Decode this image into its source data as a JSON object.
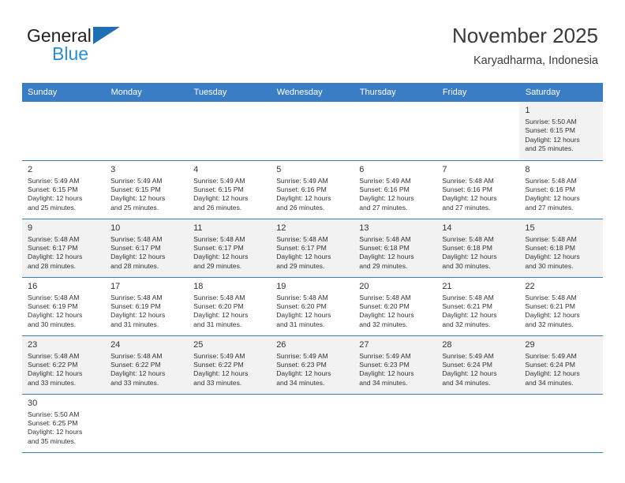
{
  "brand": {
    "line1": "General",
    "line2": "Blue",
    "triangle_color": "#1f6fb5",
    "blue_text_color": "#2a8fd8"
  },
  "header": {
    "title": "November 2025",
    "subtitle": "Karyadharma, Indonesia"
  },
  "theme": {
    "header_bg": "#3b7dc4",
    "header_text": "#ffffff",
    "row_shade": "#f2f2f2",
    "grid_line": "#3b7dc4"
  },
  "weekdays": [
    "Sunday",
    "Monday",
    "Tuesday",
    "Wednesday",
    "Thursday",
    "Friday",
    "Saturday"
  ],
  "weeks": [
    [
      {
        "empty": true
      },
      {
        "empty": true
      },
      {
        "empty": true
      },
      {
        "empty": true
      },
      {
        "empty": true
      },
      {
        "empty": true
      },
      {
        "day": "1",
        "sunrise": "Sunrise: 5:50 AM",
        "sunset": "Sunset: 6:15 PM",
        "daylight1": "Daylight: 12 hours",
        "daylight2": "and 25 minutes."
      }
    ],
    [
      {
        "day": "2",
        "sunrise": "Sunrise: 5:49 AM",
        "sunset": "Sunset: 6:15 PM",
        "daylight1": "Daylight: 12 hours",
        "daylight2": "and 25 minutes."
      },
      {
        "day": "3",
        "sunrise": "Sunrise: 5:49 AM",
        "sunset": "Sunset: 6:15 PM",
        "daylight1": "Daylight: 12 hours",
        "daylight2": "and 25 minutes."
      },
      {
        "day": "4",
        "sunrise": "Sunrise: 5:49 AM",
        "sunset": "Sunset: 6:15 PM",
        "daylight1": "Daylight: 12 hours",
        "daylight2": "and 26 minutes."
      },
      {
        "day": "5",
        "sunrise": "Sunrise: 5:49 AM",
        "sunset": "Sunset: 6:16 PM",
        "daylight1": "Daylight: 12 hours",
        "daylight2": "and 26 minutes."
      },
      {
        "day": "6",
        "sunrise": "Sunrise: 5:49 AM",
        "sunset": "Sunset: 6:16 PM",
        "daylight1": "Daylight: 12 hours",
        "daylight2": "and 27 minutes."
      },
      {
        "day": "7",
        "sunrise": "Sunrise: 5:48 AM",
        "sunset": "Sunset: 6:16 PM",
        "daylight1": "Daylight: 12 hours",
        "daylight2": "and 27 minutes."
      },
      {
        "day": "8",
        "sunrise": "Sunrise: 5:48 AM",
        "sunset": "Sunset: 6:16 PM",
        "daylight1": "Daylight: 12 hours",
        "daylight2": "and 27 minutes."
      }
    ],
    [
      {
        "day": "9",
        "sunrise": "Sunrise: 5:48 AM",
        "sunset": "Sunset: 6:17 PM",
        "daylight1": "Daylight: 12 hours",
        "daylight2": "and 28 minutes."
      },
      {
        "day": "10",
        "sunrise": "Sunrise: 5:48 AM",
        "sunset": "Sunset: 6:17 PM",
        "daylight1": "Daylight: 12 hours",
        "daylight2": "and 28 minutes."
      },
      {
        "day": "11",
        "sunrise": "Sunrise: 5:48 AM",
        "sunset": "Sunset: 6:17 PM",
        "daylight1": "Daylight: 12 hours",
        "daylight2": "and 29 minutes."
      },
      {
        "day": "12",
        "sunrise": "Sunrise: 5:48 AM",
        "sunset": "Sunset: 6:17 PM",
        "daylight1": "Daylight: 12 hours",
        "daylight2": "and 29 minutes."
      },
      {
        "day": "13",
        "sunrise": "Sunrise: 5:48 AM",
        "sunset": "Sunset: 6:18 PM",
        "daylight1": "Daylight: 12 hours",
        "daylight2": "and 29 minutes."
      },
      {
        "day": "14",
        "sunrise": "Sunrise: 5:48 AM",
        "sunset": "Sunset: 6:18 PM",
        "daylight1": "Daylight: 12 hours",
        "daylight2": "and 30 minutes."
      },
      {
        "day": "15",
        "sunrise": "Sunrise: 5:48 AM",
        "sunset": "Sunset: 6:18 PM",
        "daylight1": "Daylight: 12 hours",
        "daylight2": "and 30 minutes."
      }
    ],
    [
      {
        "day": "16",
        "sunrise": "Sunrise: 5:48 AM",
        "sunset": "Sunset: 6:19 PM",
        "daylight1": "Daylight: 12 hours",
        "daylight2": "and 30 minutes."
      },
      {
        "day": "17",
        "sunrise": "Sunrise: 5:48 AM",
        "sunset": "Sunset: 6:19 PM",
        "daylight1": "Daylight: 12 hours",
        "daylight2": "and 31 minutes."
      },
      {
        "day": "18",
        "sunrise": "Sunrise: 5:48 AM",
        "sunset": "Sunset: 6:20 PM",
        "daylight1": "Daylight: 12 hours",
        "daylight2": "and 31 minutes."
      },
      {
        "day": "19",
        "sunrise": "Sunrise: 5:48 AM",
        "sunset": "Sunset: 6:20 PM",
        "daylight1": "Daylight: 12 hours",
        "daylight2": "and 31 minutes."
      },
      {
        "day": "20",
        "sunrise": "Sunrise: 5:48 AM",
        "sunset": "Sunset: 6:20 PM",
        "daylight1": "Daylight: 12 hours",
        "daylight2": "and 32 minutes."
      },
      {
        "day": "21",
        "sunrise": "Sunrise: 5:48 AM",
        "sunset": "Sunset: 6:21 PM",
        "daylight1": "Daylight: 12 hours",
        "daylight2": "and 32 minutes."
      },
      {
        "day": "22",
        "sunrise": "Sunrise: 5:48 AM",
        "sunset": "Sunset: 6:21 PM",
        "daylight1": "Daylight: 12 hours",
        "daylight2": "and 32 minutes."
      }
    ],
    [
      {
        "day": "23",
        "sunrise": "Sunrise: 5:48 AM",
        "sunset": "Sunset: 6:22 PM",
        "daylight1": "Daylight: 12 hours",
        "daylight2": "and 33 minutes."
      },
      {
        "day": "24",
        "sunrise": "Sunrise: 5:48 AM",
        "sunset": "Sunset: 6:22 PM",
        "daylight1": "Daylight: 12 hours",
        "daylight2": "and 33 minutes."
      },
      {
        "day": "25",
        "sunrise": "Sunrise: 5:49 AM",
        "sunset": "Sunset: 6:22 PM",
        "daylight1": "Daylight: 12 hours",
        "daylight2": "and 33 minutes."
      },
      {
        "day": "26",
        "sunrise": "Sunrise: 5:49 AM",
        "sunset": "Sunset: 6:23 PM",
        "daylight1": "Daylight: 12 hours",
        "daylight2": "and 34 minutes."
      },
      {
        "day": "27",
        "sunrise": "Sunrise: 5:49 AM",
        "sunset": "Sunset: 6:23 PM",
        "daylight1": "Daylight: 12 hours",
        "daylight2": "and 34 minutes."
      },
      {
        "day": "28",
        "sunrise": "Sunrise: 5:49 AM",
        "sunset": "Sunset: 6:24 PM",
        "daylight1": "Daylight: 12 hours",
        "daylight2": "and 34 minutes."
      },
      {
        "day": "29",
        "sunrise": "Sunrise: 5:49 AM",
        "sunset": "Sunset: 6:24 PM",
        "daylight1": "Daylight: 12 hours",
        "daylight2": "and 34 minutes."
      }
    ],
    [
      {
        "day": "30",
        "sunrise": "Sunrise: 5:50 AM",
        "sunset": "Sunset: 6:25 PM",
        "daylight1": "Daylight: 12 hours",
        "daylight2": "and 35 minutes."
      },
      {
        "empty": true
      },
      {
        "empty": true
      },
      {
        "empty": true
      },
      {
        "empty": true
      },
      {
        "empty": true
      },
      {
        "empty": true
      }
    ]
  ]
}
